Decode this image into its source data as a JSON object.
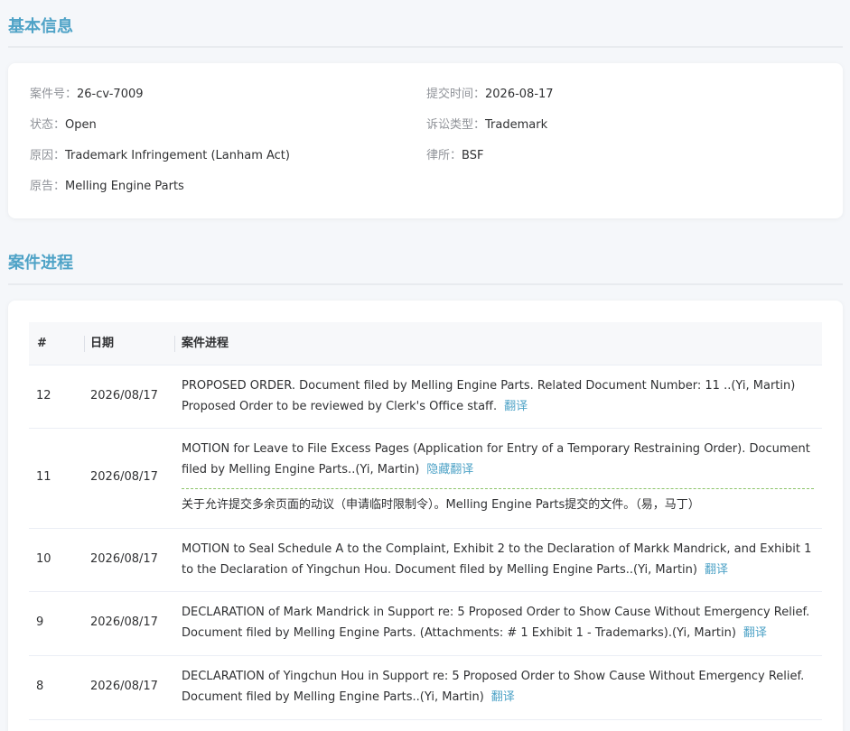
{
  "basic_info": {
    "title": "基本信息",
    "fields": [
      {
        "label": "案件号：",
        "value": "26-cv-7009"
      },
      {
        "label": "提交时间：",
        "value": "2026-08-17"
      },
      {
        "label": "状态：",
        "value": "Open"
      },
      {
        "label": "诉讼类型：",
        "value": "Trademark"
      },
      {
        "label": "原因：",
        "value": "Trademark Infringement (Lanham Act)"
      },
      {
        "label": "律所：",
        "value": "BSF"
      },
      {
        "label": "原告：",
        "value": "Melling Engine Parts"
      }
    ]
  },
  "progress": {
    "title": "案件进程",
    "headers": {
      "num": "#",
      "date": "日期",
      "content": "案件进程"
    },
    "rows": [
      {
        "num": "12",
        "date": "2026/08/17",
        "text": "PROPOSED ORDER. Document filed by Melling Engine Parts. Related Document Number: 11 ..(Yi, Martin) Proposed Order to be reviewed by Clerk's Office staff.",
        "action": "翻译"
      },
      {
        "num": "11",
        "date": "2026/08/17",
        "text": "MOTION for Leave to File Excess Pages (Application for Entry of a Temporary Restraining Order). Document filed by Melling Engine Parts..(Yi, Martin)",
        "action": "隐藏翻译",
        "translation": "关于允许提交多余页面的动议（申请临时限制令）。Melling Engine Parts提交的文件。（易，马丁）"
      },
      {
        "num": "10",
        "date": "2026/08/17",
        "text": "MOTION to Seal Schedule A to the Complaint, Exhibit 2 to the Declaration of Markk Mandrick, and Exhibit 1 to the Declaration of Yingchun Hou. Document filed by Melling Engine Parts..(Yi, Martin)",
        "action": "翻译"
      },
      {
        "num": "9",
        "date": "2026/08/17",
        "text": "DECLARATION of Mark Mandrick in Support re: 5 Proposed Order to Show Cause Without Emergency Relief. Document filed by Melling Engine Parts. (Attachments: # 1 Exhibit 1 - Trademarks).(Yi, Martin)",
        "action": "翻译"
      },
      {
        "num": "8",
        "date": "2026/08/17",
        "text": "DECLARATION of Yingchun Hou in Support re: 5 Proposed Order to Show Cause Without Emergency Relief. Document filed by Melling Engine Parts..(Yi, Martin)",
        "action": "翻译"
      }
    ]
  }
}
